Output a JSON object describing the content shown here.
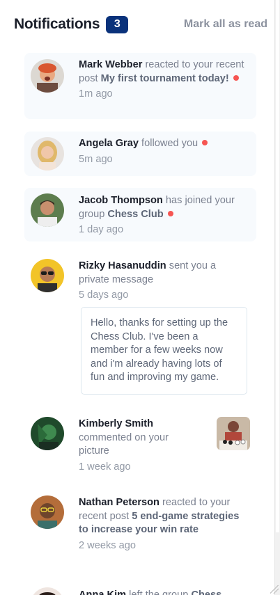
{
  "header": {
    "title": "Notifications",
    "unread_count": "3",
    "mark_all": "Mark all as read"
  },
  "notifications": [
    {
      "name": "Mark Webber",
      "action": "reacted to your recent post",
      "target": "My first tournament today!",
      "time": "1m ago",
      "unread": true
    },
    {
      "name": "Angela Gray",
      "action": "followed you",
      "target": "",
      "time": "5m ago",
      "unread": true
    },
    {
      "name": "Jacob Thompson",
      "action": "has joined your group",
      "target": "Chess Club",
      "time": "1 day ago",
      "unread": true
    },
    {
      "name": "Rizky Hasanuddin",
      "action": "sent you a private message",
      "target": "",
      "time": "5 days ago",
      "unread": false,
      "message": "Hello, thanks for setting up the Chess Club. I've been a member for a few weeks now and i'm already having lots of fun and improving my game."
    },
    {
      "name": "Kimberly Smith",
      "action": "commented on your picture",
      "target": "",
      "time": "1 week ago",
      "unread": false
    },
    {
      "name": "Nathan Peterson",
      "action": "reacted to your recent post",
      "target": "5 end-game strategies to increase your win rate",
      "time": "2 weeks ago",
      "unread": false
    },
    {
      "name": "Anna Kim",
      "action": "left the group",
      "target": "Chess Club",
      "time": "",
      "unread": false
    }
  ],
  "colors": {
    "badge": "#0a327b",
    "unread_dot": "#f65552",
    "unread_bg": "#f7fafd"
  }
}
